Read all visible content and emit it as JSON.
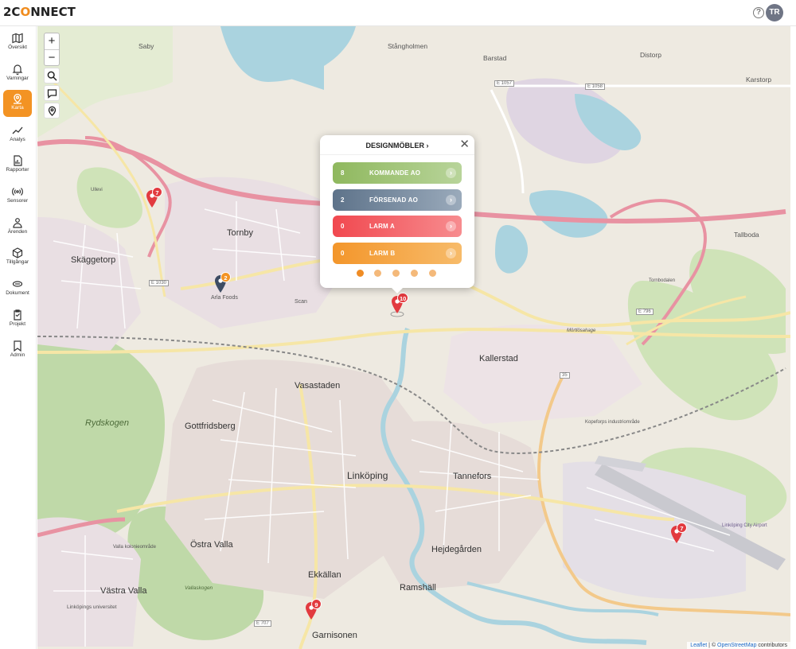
{
  "app": {
    "logo_prefix": "2C",
    "logo_accent": "O",
    "logo_suffix": "NNECT",
    "help_label": "?",
    "avatar_initials": "TR"
  },
  "sidebar": {
    "items": [
      {
        "label": "Översikt",
        "icon": "map-book-icon"
      },
      {
        "label": "Varningar",
        "icon": "bell-icon"
      },
      {
        "label": "Karta",
        "icon": "map-pin-icon"
      },
      {
        "label": "Analys",
        "icon": "trend-icon"
      },
      {
        "label": "Rapporter",
        "icon": "report-icon"
      },
      {
        "label": "Sensorer",
        "icon": "sensor-icon"
      },
      {
        "label": "Ärenden",
        "icon": "person-icon"
      },
      {
        "label": "Tillgångar",
        "icon": "cube-icon"
      },
      {
        "label": "Dokument",
        "icon": "document-icon"
      },
      {
        "label": "Projekt",
        "icon": "clipboard-icon"
      },
      {
        "label": "Admin",
        "icon": "bookmark-icon"
      }
    ],
    "active_index": 2
  },
  "map_controls": {
    "zoom_in": "+",
    "zoom_out": "−"
  },
  "markers": [
    {
      "count": "7",
      "color": "#e23a3f"
    },
    {
      "count": "2",
      "color": "#f39323"
    },
    {
      "count": "10",
      "color": "#e23a3f"
    },
    {
      "count": "7",
      "color": "#e23a3f"
    },
    {
      "count": "9",
      "color": "#e23a3f"
    }
  ],
  "popup": {
    "title": "DESIGNMÖBLER",
    "title_chevron": "›",
    "close": "✕",
    "rows": [
      {
        "count": "8",
        "label": "KOMMANDE AO"
      },
      {
        "count": "2",
        "label": "FÖRSENAD AO"
      },
      {
        "count": "0",
        "label": "LARM A"
      },
      {
        "count": "0",
        "label": "LARM B"
      }
    ],
    "go_glyph": "›",
    "page_count": 5,
    "active_page": 0
  },
  "places": [
    "Saby",
    "Stångholmen",
    "Barstad",
    "Distorp",
    "Karstorp",
    "Tornby",
    "Skäggetorp",
    "Arla Foods",
    "Scan",
    "Kallerstad",
    "Vasastaden",
    "Gottfridsberg",
    "Linköping",
    "Tannefors",
    "Östra Valla",
    "Västra Valla",
    "Ekkällan",
    "Hejdegården",
    "Ramshäll",
    "Garnisonen",
    "Tallboda",
    "Ullevi",
    "Rydskogen",
    "Kopeforps industriområde",
    "Linköping City Airport",
    "Valla kolonieområde",
    "Vallaskogen",
    "Linköpings universitet",
    "Tornbodalen",
    "Mörtlösahage"
  ],
  "roads": [
    "E 1057",
    "E 1058",
    "E 1030",
    "E 796",
    "E 707",
    "35"
  ],
  "attribution": {
    "leaflet": "Leaflet",
    "sep": " | © ",
    "osm": "OpenStreetMap",
    "suffix": " contributors"
  },
  "colors": {
    "accent": "#f39323",
    "alarm": "#e23a3f",
    "upcoming": "#8fb85e",
    "delayed": "#5e738a"
  }
}
